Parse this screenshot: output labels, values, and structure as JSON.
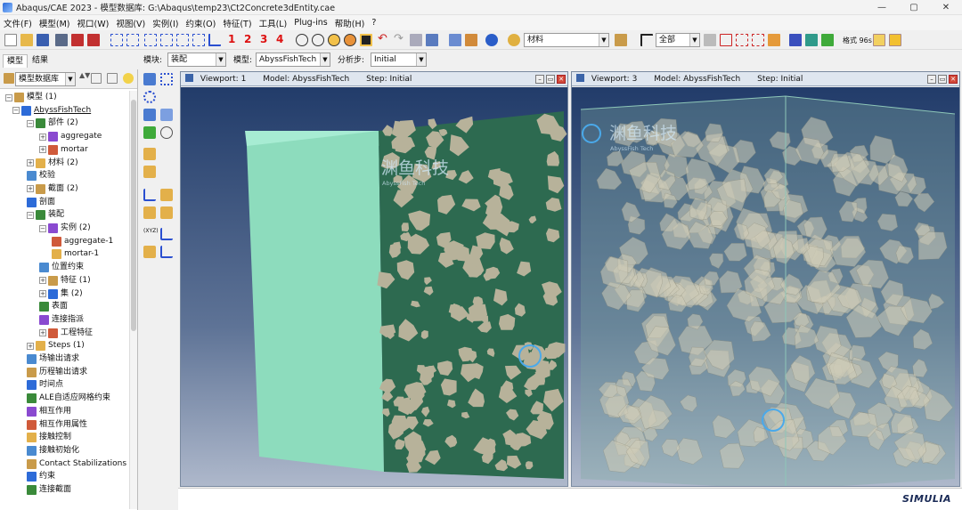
{
  "window": {
    "title": "Abaqus/CAE 2023 - 模型数据库: G:\\Abaqus\\temp23\\Ct2Concrete3dEntity.cae",
    "min": "—",
    "max": "▢",
    "close": "✕"
  },
  "menu": [
    "文件(F)",
    "模型(M)",
    "视口(W)",
    "视图(V)",
    "实例(I)",
    "约束(O)",
    "特征(T)",
    "工具(L)",
    "Plug-ins",
    "帮助(H)",
    "?"
  ],
  "toolbar": {
    "num1": "1",
    "num2": "2",
    "num3": "3",
    "num4": "4",
    "material_combo": "材料",
    "selection_combo": "全部",
    "mesh_label": "格式 96s"
  },
  "tabs": {
    "model": "模型",
    "results": "结果"
  },
  "context": {
    "module_label": "模块:",
    "module_value": "装配",
    "model_label": "模型:",
    "model_value": "AbyssFishTech",
    "step_label": "分析步:",
    "step_value": "Initial"
  },
  "tree": {
    "header_combo": "模型数据库",
    "nodes": [
      {
        "label": "模型 (1)",
        "exp": "−",
        "x": 6
      },
      {
        "label": "AbyssFishTech",
        "exp": "−",
        "x": 14,
        "underline": true
      },
      {
        "label": "部件 (2)",
        "exp": "−",
        "x": 30
      },
      {
        "label": "aggregate",
        "exp": "+",
        "x": 44
      },
      {
        "label": "mortar",
        "exp": "+",
        "x": 44
      },
      {
        "label": "材料 (2)",
        "exp": "+",
        "x": 30
      },
      {
        "label": "校验",
        "exp": "",
        "x": 30
      },
      {
        "label": "截面 (2)",
        "exp": "+",
        "x": 30
      },
      {
        "label": "剖面",
        "exp": "",
        "x": 30
      },
      {
        "label": "装配",
        "exp": "−",
        "x": 30
      },
      {
        "label": "实例 (2)",
        "exp": "−",
        "x": 44
      },
      {
        "label": "aggregate-1",
        "exp": "",
        "x": 58
      },
      {
        "label": "mortar-1",
        "exp": "",
        "x": 58
      },
      {
        "label": "位置约束",
        "exp": "",
        "x": 44
      },
      {
        "label": "特征 (1)",
        "exp": "+",
        "x": 44
      },
      {
        "label": "集 (2)",
        "exp": "+",
        "x": 44
      },
      {
        "label": "表面",
        "exp": "",
        "x": 44
      },
      {
        "label": "连接指派",
        "exp": "",
        "x": 44
      },
      {
        "label": "工程特征",
        "exp": "+",
        "x": 44
      },
      {
        "label": "Steps (1)",
        "exp": "+",
        "x": 30
      },
      {
        "label": "场输出请求",
        "exp": "",
        "x": 30
      },
      {
        "label": "历程输出请求",
        "exp": "",
        "x": 30
      },
      {
        "label": "时间点",
        "exp": "",
        "x": 30
      },
      {
        "label": "ALE自适应网格约束",
        "exp": "",
        "x": 30
      },
      {
        "label": "相互作用",
        "exp": "",
        "x": 30
      },
      {
        "label": "相互作用属性",
        "exp": "",
        "x": 30
      },
      {
        "label": "接触控制",
        "exp": "",
        "x": 30
      },
      {
        "label": "接触初始化",
        "exp": "",
        "x": 30
      },
      {
        "label": "Contact Stabilizations",
        "exp": "",
        "x": 30
      },
      {
        "label": "约束",
        "exp": "",
        "x": 30
      },
      {
        "label": "连接截面",
        "exp": "",
        "x": 30
      }
    ]
  },
  "viewports": [
    {
      "title": "Viewport: 1",
      "model": "Model: AbyssFishTech",
      "step": "Step: Initial"
    },
    {
      "title": "Viewport: 3",
      "model": "Model: AbyssFishTech",
      "step": "Step: Initial"
    }
  ],
  "watermark": {
    "cn": "渊鱼科技",
    "en": "AbyssFish Tech"
  },
  "brand": "SIMULIA",
  "colors": {
    "mortar_face": "#8fdcc0",
    "section_face": "#2f6b4f",
    "aggregate": "#b7b29a",
    "viewport_top": "#223c6a",
    "viewport_bottom": "#aeb8cb"
  }
}
